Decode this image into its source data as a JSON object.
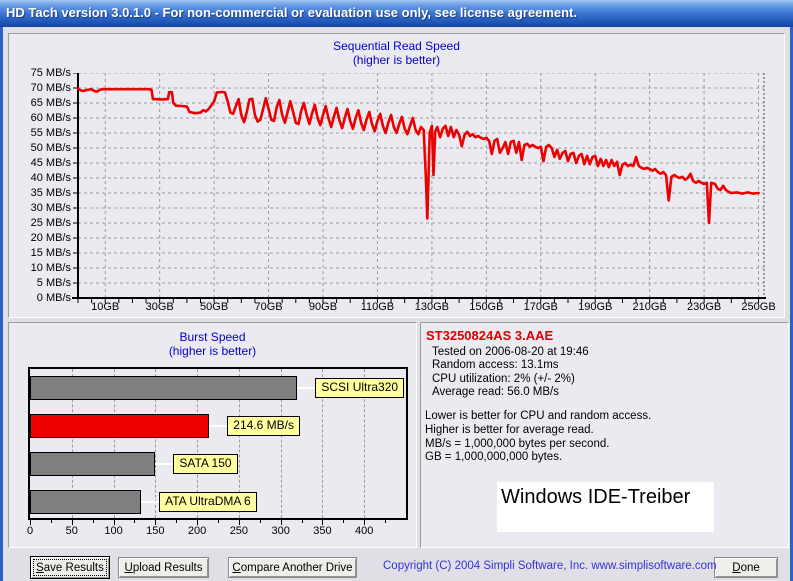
{
  "window": {
    "title": "HD Tach version 3.0.1.0  - For non-commercial or evaluation use only, see license agreement."
  },
  "chart_data": [
    {
      "type": "line",
      "title": "Sequential Read Speed",
      "subtitle": "(higher is better)",
      "xlabel_unit": "GB",
      "ylabel_unit": "MB/s",
      "xlim": [
        0,
        252
      ],
      "ylim": [
        0,
        75
      ],
      "grid": true,
      "line_color": "#ec0000",
      "x_tick_values": [
        10,
        30,
        50,
        70,
        90,
        110,
        130,
        150,
        170,
        190,
        210,
        230,
        250
      ],
      "x_minor_tick_step": 5,
      "y_tick_values": [
        0,
        5,
        10,
        15,
        20,
        25,
        30,
        35,
        40,
        45,
        50,
        55,
        60,
        65,
        70,
        75
      ],
      "series": [
        {
          "name": "sequential-read-speed",
          "points": [
            [
              0,
              69.8
            ],
            [
              1,
              69.2
            ],
            [
              2,
              69.0
            ],
            [
              3,
              69.3
            ],
            [
              5,
              69.6
            ],
            [
              6,
              69.0
            ],
            [
              7,
              68.8
            ],
            [
              8,
              69.4
            ],
            [
              9,
              69.6
            ],
            [
              14,
              69.6
            ],
            [
              20,
              69.6
            ],
            [
              26,
              69.6
            ],
            [
              27,
              69.4
            ],
            [
              27.5,
              66.3
            ],
            [
              31,
              66.2
            ],
            [
              33,
              66.3
            ],
            [
              33.5,
              68.6
            ],
            [
              34.5,
              68.6
            ],
            [
              35,
              65.0
            ],
            [
              36,
              64.1
            ],
            [
              38,
              64.0
            ],
            [
              40,
              63.8
            ],
            [
              41,
              62.0
            ],
            [
              43,
              61.6
            ],
            [
              45,
              61.8
            ],
            [
              46,
              62.6
            ],
            [
              47,
              62.2
            ],
            [
              48,
              63.0
            ],
            [
              50,
              65.5
            ],
            [
              51,
              68.5
            ],
            [
              53,
              68.7
            ],
            [
              54,
              68.5
            ],
            [
              55,
              65.5
            ],
            [
              56,
              61.8
            ],
            [
              57,
              61.4
            ],
            [
              58,
              64.0
            ],
            [
              59,
              66.3
            ],
            [
              60,
              61.0
            ],
            [
              61,
              58.6
            ],
            [
              62,
              62.0
            ],
            [
              63,
              66.2
            ],
            [
              64,
              66.4
            ],
            [
              65,
              61.0
            ],
            [
              66,
              58.8
            ],
            [
              67,
              59.4
            ],
            [
              68,
              63.0
            ],
            [
              69,
              66.6
            ],
            [
              70,
              63.0
            ],
            [
              71,
              59.4
            ],
            [
              72,
              59.0
            ],
            [
              73,
              63.6
            ],
            [
              74,
              66.0
            ],
            [
              75,
              61.0
            ],
            [
              76,
              58.4
            ],
            [
              77,
              62.0
            ],
            [
              78,
              65.6
            ],
            [
              79,
              62.0
            ],
            [
              80,
              58.4
            ],
            [
              81,
              58.0
            ],
            [
              82,
              62.4
            ],
            [
              83,
              65.0
            ],
            [
              84,
              61.0
            ],
            [
              85,
              58.0
            ],
            [
              86,
              61.6
            ],
            [
              87,
              64.4
            ],
            [
              88,
              60.0
            ],
            [
              89,
              57.6
            ],
            [
              90,
              61.0
            ],
            [
              91,
              64.0
            ],
            [
              92,
              60.0
            ],
            [
              93,
              57.0
            ],
            [
              94,
              60.4
            ],
            [
              95,
              63.4
            ],
            [
              96,
              59.4
            ],
            [
              97,
              56.6
            ],
            [
              98,
              60.0
            ],
            [
              99,
              63.0
            ],
            [
              100,
              59.0
            ],
            [
              101,
              56.4
            ],
            [
              102,
              60.0
            ],
            [
              103,
              62.6
            ],
            [
              104,
              58.4
            ],
            [
              105,
              56.0
            ],
            [
              106,
              59.6
            ],
            [
              107,
              62.0
            ],
            [
              108,
              58.0
            ],
            [
              109,
              55.6
            ],
            [
              110,
              59.0
            ],
            [
              111,
              61.4
            ],
            [
              112,
              57.4
            ],
            [
              113,
              55.0
            ],
            [
              114,
              58.4
            ],
            [
              115,
              61.0
            ],
            [
              116,
              57.0
            ],
            [
              117,
              55.0
            ],
            [
              118,
              58.0
            ],
            [
              119,
              60.4
            ],
            [
              120,
              56.4
            ],
            [
              121,
              54.6
            ],
            [
              122,
              57.4
            ],
            [
              123,
              60.0
            ],
            [
              124,
              56.0
            ],
            [
              125,
              54.6
            ],
            [
              126,
              57.0
            ],
            [
              127,
              56.0
            ],
            [
              127.8,
              40.0
            ],
            [
              128.3,
              26.5
            ],
            [
              128.8,
              41.0
            ],
            [
              129.2,
              55.0
            ],
            [
              130,
              57.4
            ],
            [
              130.6,
              41.0
            ],
            [
              131.2,
              55.4
            ],
            [
              132,
              57.0
            ],
            [
              133,
              53.6
            ],
            [
              134,
              56.4
            ],
            [
              135,
              57.4
            ],
            [
              136,
              54.0
            ],
            [
              137,
              57.0
            ],
            [
              138,
              53.6
            ],
            [
              139,
              56.0
            ],
            [
              140,
              54.4
            ],
            [
              141,
              50.6
            ],
            [
              142,
              54.4
            ],
            [
              143,
              55.4
            ],
            [
              144,
              54.0
            ],
            [
              145,
              54.6
            ],
            [
              146,
              53.6
            ],
            [
              147,
              54.0
            ],
            [
              148,
              53.4
            ],
            [
              149,
              53.0
            ],
            [
              150,
              53.4
            ],
            [
              151,
              52.4
            ],
            [
              152,
              48.0
            ],
            [
              153,
              52.4
            ],
            [
              154,
              53.0
            ],
            [
              155,
              48.4
            ],
            [
              156,
              50.0
            ],
            [
              157,
              52.0
            ],
            [
              158,
              48.0
            ],
            [
              159,
              52.0
            ],
            [
              160,
              52.4
            ],
            [
              161,
              48.4
            ],
            [
              162,
              52.0
            ],
            [
              163,
              46.0
            ],
            [
              164,
              51.0
            ],
            [
              165,
              51.4
            ],
            [
              166,
              50.4
            ],
            [
              167,
              51.0
            ],
            [
              168,
              50.4
            ],
            [
              169,
              50.0
            ],
            [
              170,
              50.4
            ],
            [
              171,
              45.6
            ],
            [
              172,
              50.4
            ],
            [
              173,
              51.0
            ],
            [
              174,
              50.0
            ],
            [
              175,
              47.0
            ],
            [
              176,
              49.4
            ],
            [
              177,
              46.4
            ],
            [
              178,
              48.4
            ],
            [
              179,
              49.0
            ],
            [
              180,
              45.6
            ],
            [
              181,
              48.0
            ],
            [
              182,
              48.4
            ],
            [
              183,
              45.0
            ],
            [
              184,
              47.4
            ],
            [
              185,
              48.0
            ],
            [
              186,
              44.6
            ],
            [
              187,
              47.4
            ],
            [
              188,
              44.6
            ],
            [
              189,
              47.0
            ],
            [
              190,
              47.4
            ],
            [
              191,
              44.0
            ],
            [
              192,
              46.4
            ],
            [
              193,
              44.0
            ],
            [
              194,
              46.0
            ],
            [
              195,
              43.6
            ],
            [
              196,
              46.0
            ],
            [
              197,
              44.0
            ],
            [
              198,
              45.4
            ],
            [
              199,
              41.0
            ],
            [
              200,
              44.4
            ],
            [
              201,
              45.0
            ],
            [
              202,
              44.0
            ],
            [
              203,
              44.4
            ],
            [
              204,
              44.0
            ],
            [
              205,
              47.0
            ],
            [
              206,
              44.0
            ],
            [
              207,
              43.4
            ],
            [
              208,
              43.0
            ],
            [
              209,
              43.4
            ],
            [
              210,
              43.0
            ],
            [
              211,
              42.4
            ],
            [
              212,
              43.0
            ],
            [
              213,
              42.0
            ],
            [
              214,
              41.4
            ],
            [
              215,
              42.0
            ],
            [
              216,
              41.0
            ],
            [
              217,
              32.5
            ],
            [
              218,
              40.4
            ],
            [
              219,
              41.0
            ],
            [
              220,
              40.4
            ],
            [
              221,
              40.0
            ],
            [
              222,
              40.4
            ],
            [
              223,
              39.4
            ],
            [
              224,
              40.0
            ],
            [
              225,
              41.4
            ],
            [
              226,
              39.0
            ],
            [
              227,
              38.4
            ],
            [
              228,
              39.0
            ],
            [
              229,
              38.4
            ],
            [
              230,
              38.0
            ],
            [
              231,
              38.4
            ],
            [
              231.8,
              25.0
            ],
            [
              232.6,
              38.4
            ],
            [
              234,
              38.0
            ],
            [
              235,
              36.4
            ],
            [
              236,
              36.0
            ],
            [
              237,
              37.4
            ],
            [
              238,
              36.0
            ],
            [
              239,
              35.4
            ],
            [
              240,
              35.0
            ],
            [
              242,
              35.2
            ],
            [
              244,
              34.8
            ],
            [
              246,
              35.2
            ],
            [
              248,
              34.8
            ],
            [
              250,
              35.0
            ]
          ]
        }
      ]
    },
    {
      "type": "bar",
      "orientation": "horizontal",
      "title": "Burst Speed",
      "subtitle": "(higher is better)",
      "xlim": [
        0,
        450
      ],
      "x_tick_values": [
        0,
        50,
        100,
        150,
        200,
        250,
        300,
        350,
        400
      ],
      "x_minor_tick_step": 25,
      "label_bg": "#ffffa0",
      "bars": [
        {
          "label": "SCSI Ultra320",
          "value": 320,
          "color": "#7f7f7f"
        },
        {
          "label": "214.6 MB/s",
          "value": 214.6,
          "color": "#ee0000"
        },
        {
          "label": "SATA 150",
          "value": 150,
          "color": "#7f7f7f"
        },
        {
          "label": "ATA UltraDMA 6",
          "value": 133,
          "color": "#7f7f7f"
        }
      ]
    }
  ],
  "info_panel": {
    "drive_title": "ST3250824AS 3.AAE",
    "stats": [
      "Tested on 2006-08-20 at 19:46",
      "Random access: 13.1ms",
      "CPU utilization: 2% (+/- 2%)",
      "Average read: 56.0 MB/s"
    ],
    "notes": [
      "Lower is better for CPU and random access.",
      "Higher is better for average read.",
      "MB/s = 1,000,000 bytes per second.",
      "GB = 1,000,000,000 bytes."
    ],
    "overlay_note": "Windows IDE-Treiber"
  },
  "footer": {
    "save_button": "Save Results",
    "upload_button": "Upload Results",
    "compare_button": "Compare Another Drive",
    "done_button": "Done",
    "copyright": "Copyright (C) 2004 Simpli Software, Inc. www.simplisoftware.com"
  },
  "colors": {
    "title_blue": "#0000cc",
    "drive_title_red": "#dd0000",
    "line_red": "#ec0000",
    "bar_gray": "#7f7f7f",
    "bar_red": "#ee0000",
    "label_yellow": "#ffffa0",
    "copyright_blue": "#3434d6"
  }
}
